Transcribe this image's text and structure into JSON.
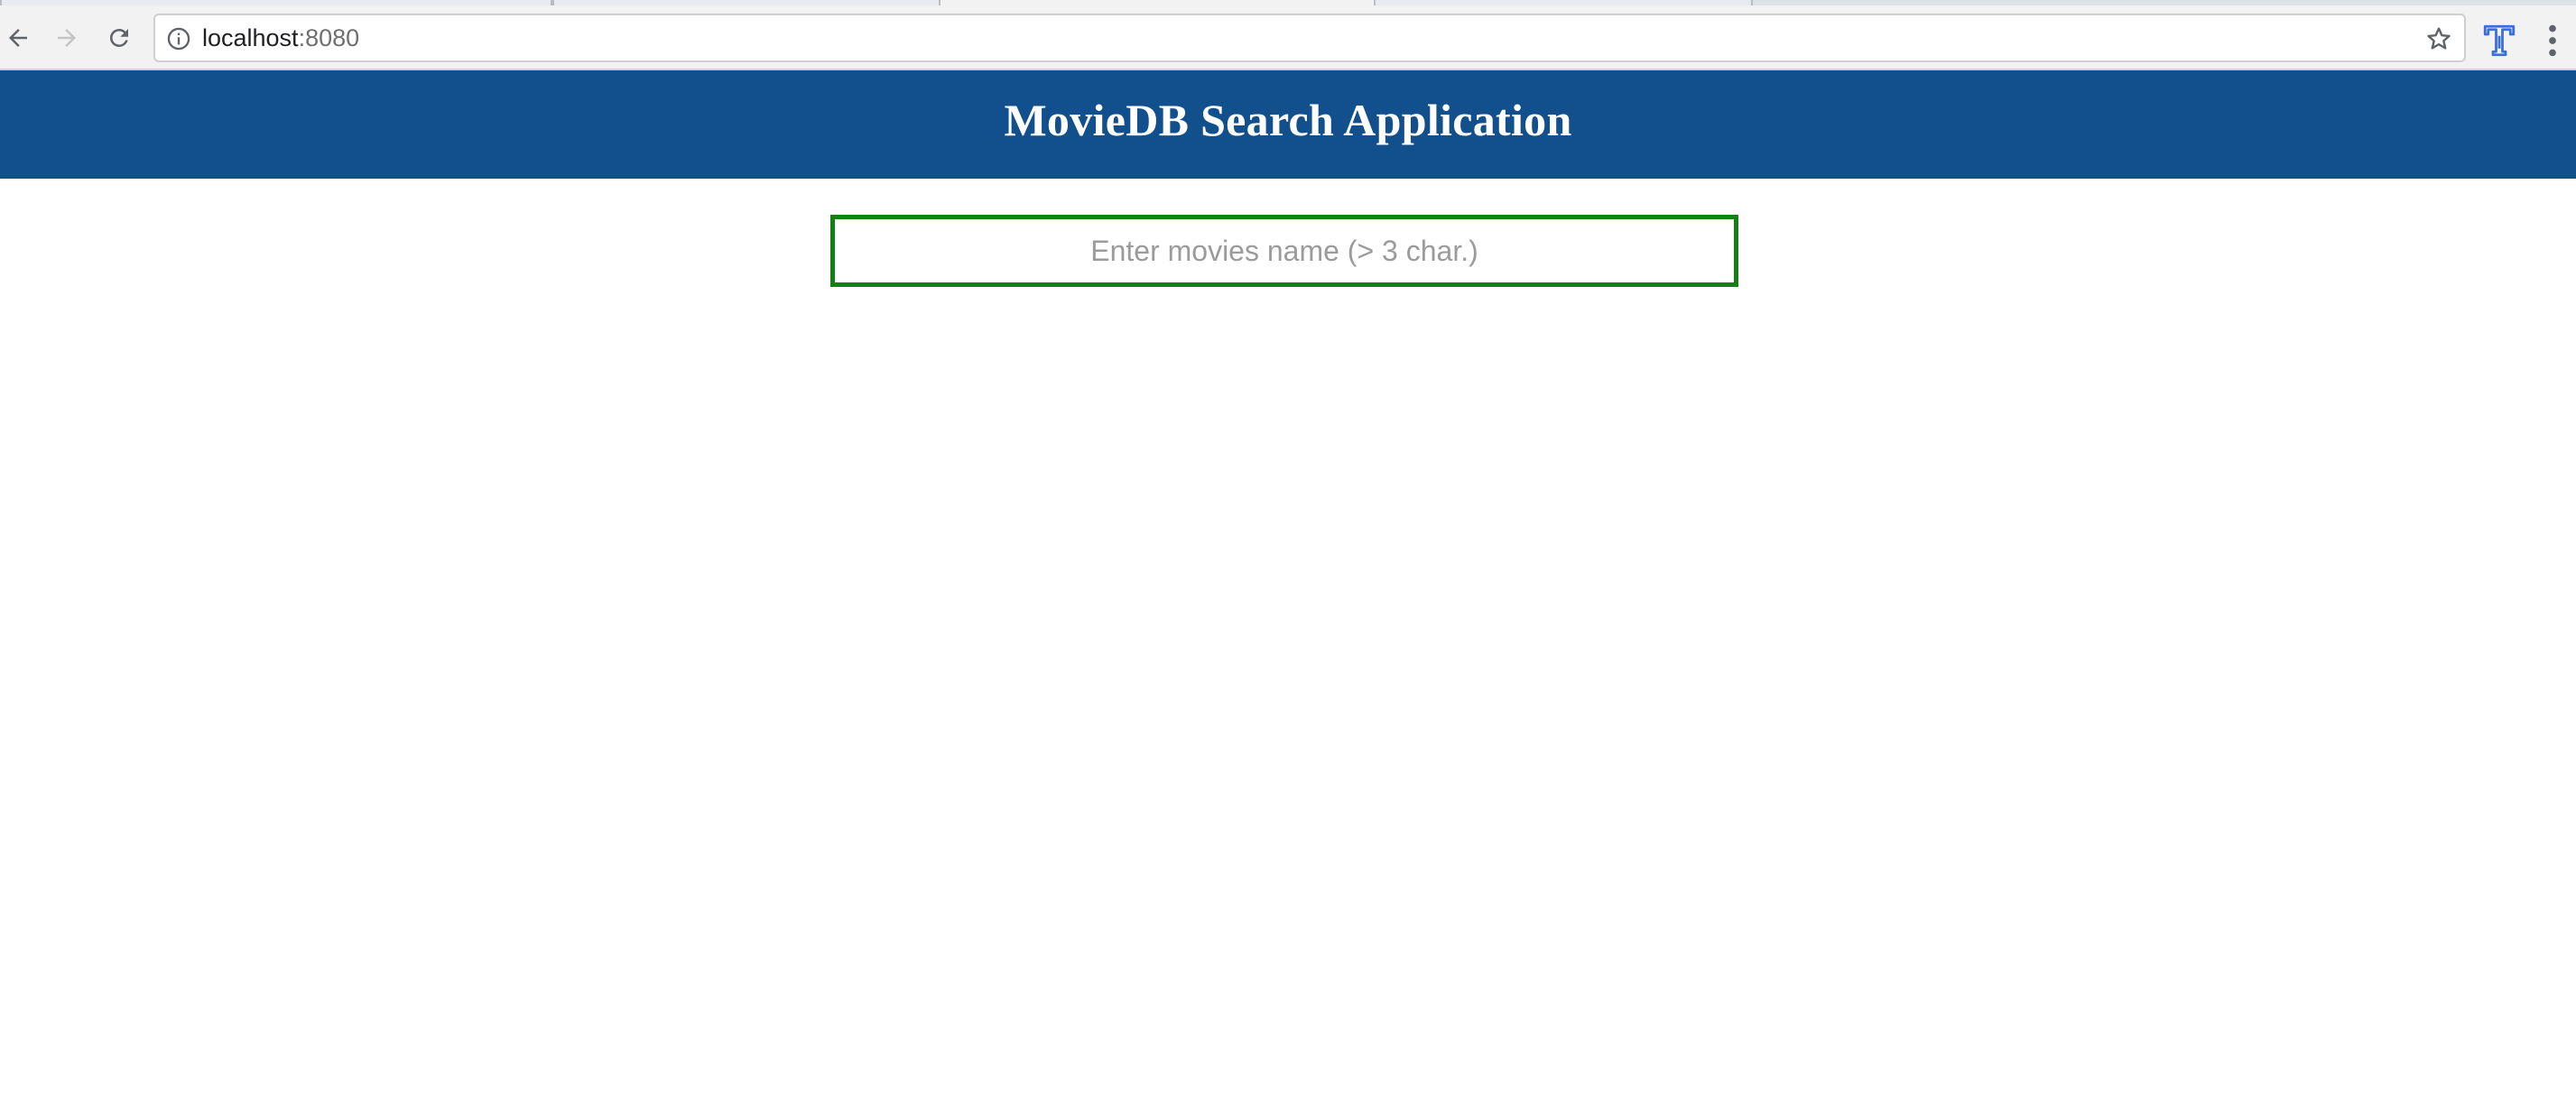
{
  "browser": {
    "url_host": "localhost",
    "url_port": ":8080",
    "icons": {
      "back": "back-arrow-icon",
      "forward": "forward-arrow-icon",
      "reload": "reload-icon",
      "site_info": "info-icon",
      "bookmark": "star-icon",
      "extension": "extension-icon",
      "menu": "kebab-menu-icon"
    }
  },
  "app": {
    "title": "MovieDB Search Application",
    "header_color": "#11508c",
    "search": {
      "value": "",
      "placeholder": "Enter movies name (> 3 char.)",
      "border_color": "#128012"
    }
  }
}
